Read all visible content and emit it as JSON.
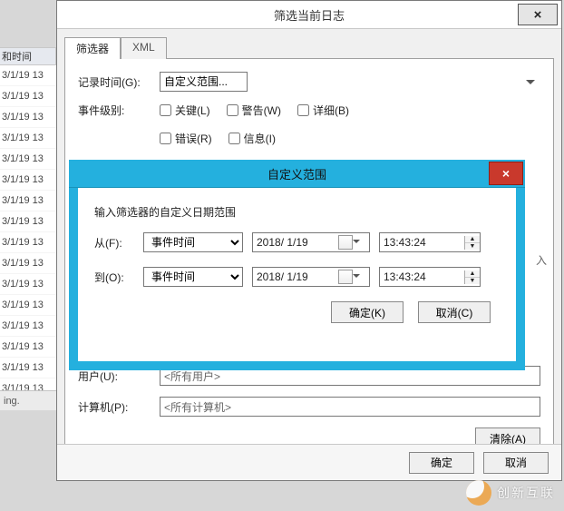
{
  "bg": {
    "col_header": "和时间",
    "rows": [
      "3/1/19 13",
      "3/1/19 13",
      "3/1/19 13",
      "3/1/19 13",
      "3/1/19 13",
      "3/1/19 13",
      "3/1/19 13",
      "3/1/19 13",
      "3/1/19 13",
      "3/1/19 13",
      "3/1/19 13",
      "3/1/19 13",
      "3/1/19 13",
      "3/1/19 13",
      "3/1/19 13",
      "3/1/19 13"
    ],
    "status": "ing."
  },
  "filterDialog": {
    "title": "筛选当前日志",
    "close": "×",
    "tab_filter": "筛选器",
    "tab_xml": "XML",
    "logged_label": "记录时间(G):",
    "logged_value": "自定义范围...",
    "level_label": "事件级别:",
    "ck_critical": "关键(L)",
    "ck_warning": "警告(W)",
    "ck_verbose": "详细(B)",
    "ck_error": "错误(R)",
    "ck_info": "信息(I)",
    "user_label": "用户(U):",
    "user_value": "<所有用户>",
    "computer_label": "计算机(P):",
    "computer_value": "<所有计算机>",
    "clear_btn": "清除(A)",
    "ok_btn": "确定",
    "cancel_btn": "取消",
    "truncated_char": "入"
  },
  "rangeModal": {
    "title": "自定义范围",
    "close": "×",
    "help": "输入筛选器的自定义日期范围",
    "from_label": "从(F):",
    "to_label": "到(O):",
    "event_time": "事件时间",
    "date_value": "2018/ 1/19",
    "time_value": "13:43:24",
    "ok": "确定(K)",
    "cancel": "取消(C)"
  },
  "brand_text": "创新互联"
}
